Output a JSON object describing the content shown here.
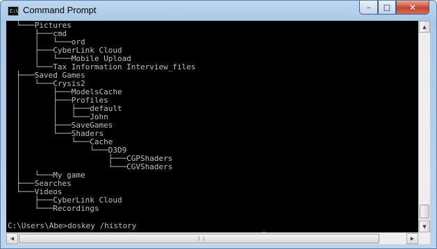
{
  "window": {
    "title": "Command Prompt",
    "icon": "console-app-icon",
    "icon_glyph": "C:\\",
    "controls": {
      "minimize": "–",
      "maximize": "□",
      "close": "✕"
    }
  },
  "console": {
    "lines": [
      "  └───Pictures",
      "      ├───cmd",
      "      │   └───ord",
      "      ├───CyberLink Cloud",
      "      │   └───Mobile Upload",
      "      └───Tax Information Interview_files",
      "  ├───Saved Games",
      "  │   └───Crysis2",
      "  │       ├───ModelsCache",
      "  │       ├───Profiles",
      "  │       │   ├───default",
      "  │       │   └───John",
      "  │       ├───SaveGames",
      "  │       └───Shaders",
      "  │           └───Cache",
      "  │               └───D3D9",
      "  │                   ├───CGPShaders",
      "  │                   └───CGVShaders",
      "  │   └───My game",
      "  ├───Searches",
      "  └───Videos",
      "      ├───CyberLink Cloud",
      "      └───Recordings"
    ],
    "prompt": "C:\\Users\\Abe>doskey /history"
  },
  "scrollbars": {
    "vertical": {
      "up": "▲",
      "down": "▼"
    },
    "horizontal": {
      "left": "◀",
      "right": "▶"
    }
  },
  "annotation": {
    "icon": "arrow-left-icon",
    "color": "#f07d22"
  },
  "colors": {
    "console_bg": "#000000",
    "console_text": "#c0c0c0",
    "close_button": "#c7442c"
  }
}
